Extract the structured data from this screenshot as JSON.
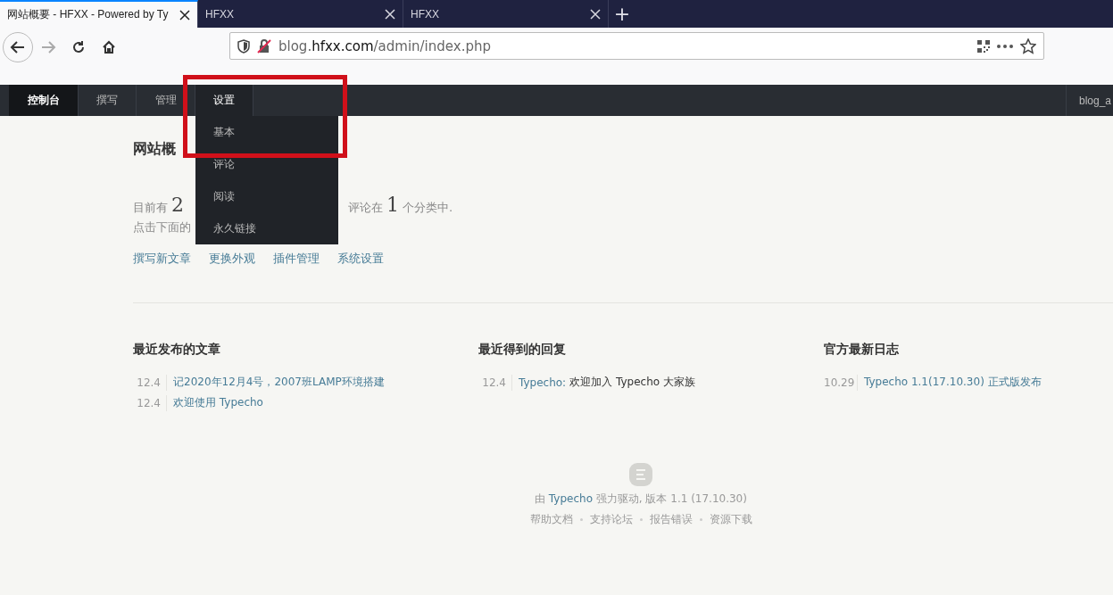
{
  "browser": {
    "tabs": [
      {
        "title": "网站概要 - HFXX - Powered by Ty",
        "selected": true
      },
      {
        "title": "HFXX",
        "selected": false
      },
      {
        "title": "HFXX",
        "selected": false
      }
    ],
    "new_tab": "+",
    "url": {
      "host_prefix": "blog.",
      "host": "hfxx.com",
      "path": "/admin/index.php"
    }
  },
  "admin_nav": {
    "items": [
      {
        "label": "控制台",
        "selected": false,
        "current": true
      },
      {
        "label": "撰写",
        "selected": false,
        "current": false
      },
      {
        "label": "管理",
        "selected": false,
        "current": false
      },
      {
        "label": "设置",
        "selected": true,
        "current": false
      }
    ],
    "user": "blog_a",
    "dropdown": {
      "items": [
        "基本",
        "评论",
        "阅读",
        "永久链接"
      ],
      "highlighted": true
    }
  },
  "overview": {
    "title": "网站概",
    "stats": [
      {
        "kind": "text",
        "text": "目前有"
      },
      {
        "kind": "number",
        "text": "2"
      },
      {
        "kind": "gap"
      },
      {
        "kind": "text",
        "text": "评论在"
      },
      {
        "kind": "number",
        "text": "1"
      },
      {
        "kind": "text",
        "text": "个分类中."
      }
    ],
    "hint": "点击下面的",
    "links": [
      "撰写新文章",
      "更换外观",
      "插件管理",
      "系统设置"
    ]
  },
  "columns": [
    {
      "title": "最近发布的文章",
      "rows": [
        {
          "date": "12.4",
          "link": "记2020年12月4号，2007班LAMP环境搭建"
        },
        {
          "date": "12.4",
          "link": "欢迎使用 Typecho"
        }
      ]
    },
    {
      "title": "最近得到的回复",
      "rows": [
        {
          "date": "12.4",
          "link": "Typecho:",
          "text": "欢迎加入 Typecho 大家族"
        }
      ]
    },
    {
      "title": "官方最新日志",
      "rows": [
        {
          "date": "10.29",
          "link": "Typecho 1.1(17.10.30) 正式版发布"
        }
      ]
    }
  ],
  "footer": {
    "prefix": "由",
    "link": "Typecho",
    "suffix": "强力驱动, 版本 1.1 (17.10.30)",
    "links": [
      "帮助文档",
      "支持论坛",
      "报告错误",
      "资源下载"
    ]
  }
}
